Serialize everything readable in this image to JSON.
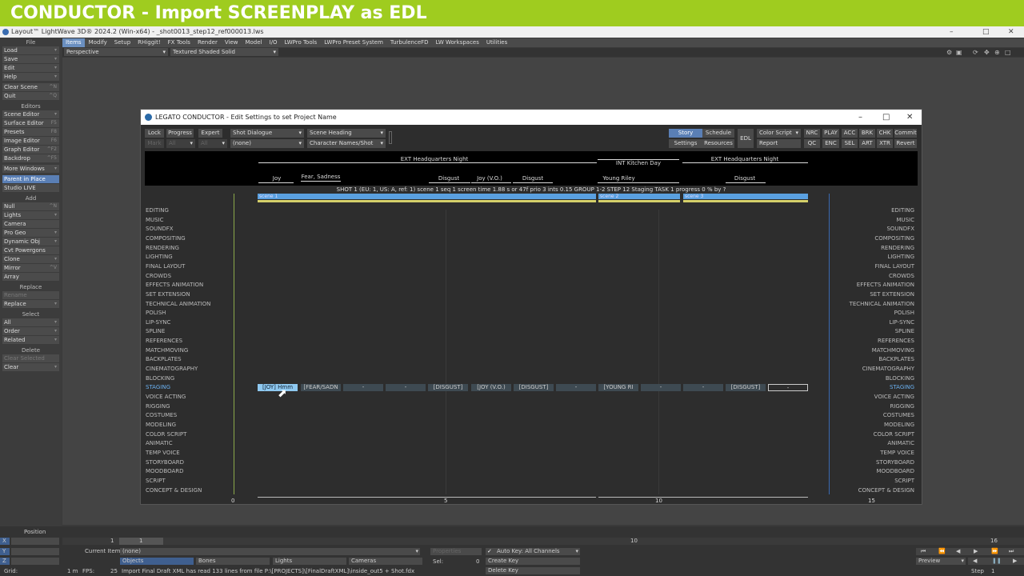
{
  "banner": {
    "title": "CONDUCTOR - Import SCREENPLAY as EDL"
  },
  "app": {
    "window_title": "Layout™ LightWave 3D® 2024.2 (Win-x64) - _shot0013_step12_ref000013.lws"
  },
  "menu": [
    "Items",
    "Modify",
    "Setup",
    "RHiggit!",
    "FX Tools",
    "Render",
    "View",
    "Model",
    "I/O",
    "LWPro Tools",
    "LWPro Preset System",
    "TurbulenceFD",
    "LW Workspaces",
    "Utilities"
  ],
  "sidebar": {
    "file_head": "File",
    "file": [
      "Load",
      "Save",
      "Edit",
      "Help"
    ],
    "file2": [
      {
        "label": "Clear Scene",
        "key": "^N"
      },
      {
        "label": "Quit",
        "key": "^Q"
      }
    ],
    "editors_head": "Editors",
    "editors": [
      {
        "label": "Scene Editor",
        "key": ""
      },
      {
        "label": "Surface Editor",
        "key": "F5"
      },
      {
        "label": "Presets",
        "key": "F8"
      },
      {
        "label": "Image Editor",
        "key": "F6"
      },
      {
        "label": "Graph Editor",
        "key": "^F2"
      },
      {
        "label": "Backdrop",
        "key": "^F5"
      }
    ],
    "more_windows": "More Windows",
    "parent_in_place": "Parent in Place",
    "studio_live": "Studio LIVE",
    "add_head": "Add",
    "add": [
      {
        "label": "Null",
        "key": "^N"
      },
      {
        "label": "Lights",
        "key": ""
      },
      {
        "label": "Camera",
        "key": ""
      },
      {
        "label": "Pro Geo",
        "key": ""
      },
      {
        "label": "Dynamic Obj",
        "key": ""
      },
      {
        "label": "Cvt Powergons",
        "key": ""
      },
      {
        "label": "Clone",
        "key": ""
      },
      {
        "label": "Mirror",
        "key": "^V"
      },
      {
        "label": "Array",
        "key": ""
      }
    ],
    "replace_head": "Replace",
    "rename": "Rename",
    "replace": "Replace",
    "select_head": "Select",
    "select": [
      "All",
      "Order",
      "Related"
    ],
    "delete_head": "Delete",
    "clear_selected": "Clear Selected",
    "clear": "Clear"
  },
  "viewport": {
    "view": "Perspective",
    "shading": "Textured Shaded Solid"
  },
  "conductor": {
    "title": "LEGATO CONDUCTOR - Edit Settings to set Project Name",
    "toolbar": {
      "lock": "Lock",
      "progress": "Progress",
      "expert": "Expert",
      "mark": "Mark",
      "all": "All",
      "all2": "All",
      "shot_dialogue": "Shot Dialogue",
      "none": "(none)",
      "scene_heading": "Scene Heading",
      "char_names": "Character Names/Shot",
      "story": "Story",
      "schedule": "Schedule",
      "settings": "Settings",
      "resources": "Resources",
      "edl": "EDL",
      "color_script": "Color Script",
      "report": "Report",
      "tags_top": [
        "NRC",
        "PLAY",
        "ACC",
        "BRK",
        "CHK",
        "Commit"
      ],
      "tags_bot": [
        "QC",
        "ENC",
        "SEL",
        "ART",
        "XTR",
        "Revert"
      ]
    },
    "headings": [
      "EXT Headquarters Night",
      "INT Kitchen Day",
      "EXT Headquarters Night"
    ],
    "emotions": [
      "Joy",
      "Fear, Sadness",
      "Disgust",
      "Joy (V.O.)",
      "Disgust",
      "Young Riley",
      "Disgust"
    ],
    "info": "SHOT 1  (EU: 1, US: A, ref: 1)    scene 1  seq 1  screen time  1.88 s or 47f  prio 3  ints 0.15      GROUP 1-2      STEP 12 Staging      TASK 1  progress 0 %  by ?",
    "scenes": [
      "scene 1",
      "scene 2",
      "scene 3"
    ],
    "rows": [
      "EDITING",
      "MUSIC",
      "SOUNDFX",
      "COMPOSITING",
      "RENDERING",
      "LIGHTING",
      "FINAL LAYOUT",
      "CROWDS",
      "EFFECTS ANIMATION",
      "SET EXTENSION",
      "TECHNICAL ANIMATION",
      "POLISH",
      "LIP-SYNC",
      "SPLINE",
      "REFERENCES",
      "MATCHMOVING",
      "BACKPLATES",
      "CINEMATOGRAPHY",
      "BLOCKING",
      "STAGING",
      "VOICE ACTING",
      "RIGGING",
      "COSTUMES",
      "MODELING",
      "COLOR SCRIPT",
      "ANIMATIC",
      "TEMP VOICE",
      "STORYBOARD",
      "MOODBOARD",
      "SCRIPT",
      "CONCEPT & DESIGN"
    ],
    "shots": [
      "[JOY] Hmm",
      "[FEAR/SADN",
      "-",
      "-",
      "[DISGUST]",
      "[JOY (V.O.)",
      "[DISGUST]",
      "-",
      "[YOUNG RI",
      "-",
      "-",
      "[DISGUST]",
      "-"
    ],
    "axis": [
      "0",
      "5",
      "10",
      "15"
    ]
  },
  "bottom": {
    "position": "Position",
    "x": "X",
    "y": "Y",
    "z": "Z",
    "x_val": "1",
    "frame": "1",
    "end_frame": "16",
    "mid_tick": "10",
    "current_item_label": "Current Item",
    "current_item": "(none)",
    "objects": "Objects",
    "bones": "Bones",
    "lights": "Lights",
    "cameras": "Cameras",
    "properties": "Properties",
    "sel_label": "Sel:",
    "sel_val": "0",
    "auto_key": "Auto Key: All Channels",
    "create_key": "Create Key",
    "delete_key": "Delete Key",
    "preview": "Preview",
    "step_label": "Step",
    "step_val": "1",
    "grid_label": "Grid:",
    "grid_val": "1 m",
    "fps_label": "FPS:",
    "fps_val": "25",
    "status": "Import Final Draft XML has read 133 lines from file P:\\[PROJECTS]\\[FinalDraftXML]\\inside_out5 + Shot.fdx"
  }
}
